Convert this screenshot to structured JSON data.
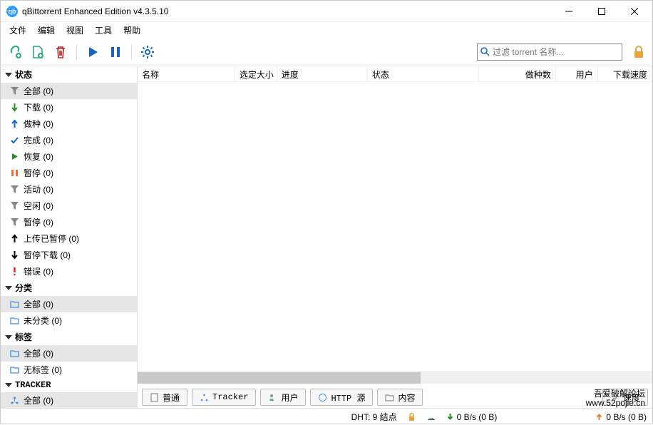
{
  "title": "qBittorrent Enhanced Edition v4.3.5.10",
  "menu": {
    "file": "文件",
    "edit": "编辑",
    "view": "视图",
    "tools": "工具",
    "help": "帮助"
  },
  "search": {
    "placeholder": "过滤 torrent 名称..."
  },
  "sidebar": {
    "status": {
      "head": "状态",
      "items": [
        {
          "label": "全部 (0)"
        },
        {
          "label": "下载 (0)"
        },
        {
          "label": "做种 (0)"
        },
        {
          "label": "完成 (0)"
        },
        {
          "label": "恢复 (0)"
        },
        {
          "label": "暂停 (0)"
        },
        {
          "label": "活动 (0)"
        },
        {
          "label": "空闲 (0)"
        },
        {
          "label": "暂停 (0)"
        },
        {
          "label": "上传已暂停 (0)"
        },
        {
          "label": "暂停下载 (0)"
        },
        {
          "label": "错误 (0)"
        }
      ]
    },
    "category": {
      "head": "分类",
      "items": [
        {
          "label": "全部 (0)"
        },
        {
          "label": "未分类 (0)"
        }
      ]
    },
    "tags": {
      "head": "标签",
      "items": [
        {
          "label": "全部 (0)"
        },
        {
          "label": "无标签 (0)"
        }
      ]
    },
    "tracker": {
      "head": "TRACKER",
      "items": [
        {
          "label": "全部 (0)"
        }
      ]
    }
  },
  "columns": {
    "name": "名称",
    "size": "选定大小",
    "progress": "进度",
    "status": "状态",
    "seeds": "做种数",
    "peers": "用户",
    "dlspeed": "下载速度"
  },
  "tabs": {
    "general": "普通",
    "tracker": "Tracker",
    "peers": "用户",
    "http": "HTTP 源",
    "content": "内容",
    "speed": "速度"
  },
  "statusbar": {
    "dht": "DHT: 9 结点",
    "dl": "0 B/s (0 B)",
    "ul": "0 B/s (0 B)"
  },
  "watermark": {
    "l1": "吾爱破解论坛",
    "l2": "www.52pojie.cn"
  }
}
